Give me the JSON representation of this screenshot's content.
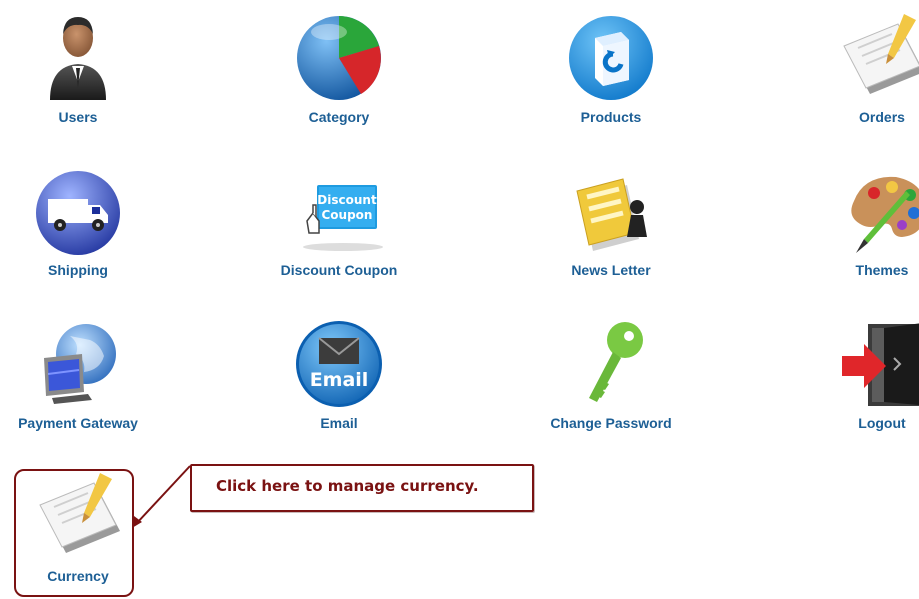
{
  "tiles": [
    {
      "label": "Users",
      "icon": "user-icon"
    },
    {
      "label": "Category",
      "icon": "category-pie-icon"
    },
    {
      "label": "Products",
      "icon": "products-box-icon"
    },
    {
      "label": "Orders",
      "icon": "orders-notepad-icon"
    },
    {
      "label": "Shipping",
      "icon": "shipping-truck-icon"
    },
    {
      "label": "Discount Coupon",
      "icon": "discount-coupon-icon"
    },
    {
      "label": "News Letter",
      "icon": "newsletter-icon"
    },
    {
      "label": "Themes",
      "icon": "palette-icon"
    },
    {
      "label": "Payment Gateway",
      "icon": "globe-monitor-icon"
    },
    {
      "label": "Email",
      "icon": "email-icon"
    },
    {
      "label": "Change Password",
      "icon": "key-icon"
    },
    {
      "label": "Logout",
      "icon": "logout-door-icon"
    },
    {
      "label": "Currency",
      "icon": "currency-notepad-icon"
    }
  ],
  "coupon_icon_text": [
    "Discount",
    "Coupon"
  ],
  "email_icon_text": "Email",
  "callout": {
    "text": "Click here to manage currency."
  },
  "colors": {
    "label": "#1d5f95",
    "callout_border": "#7a1212"
  }
}
